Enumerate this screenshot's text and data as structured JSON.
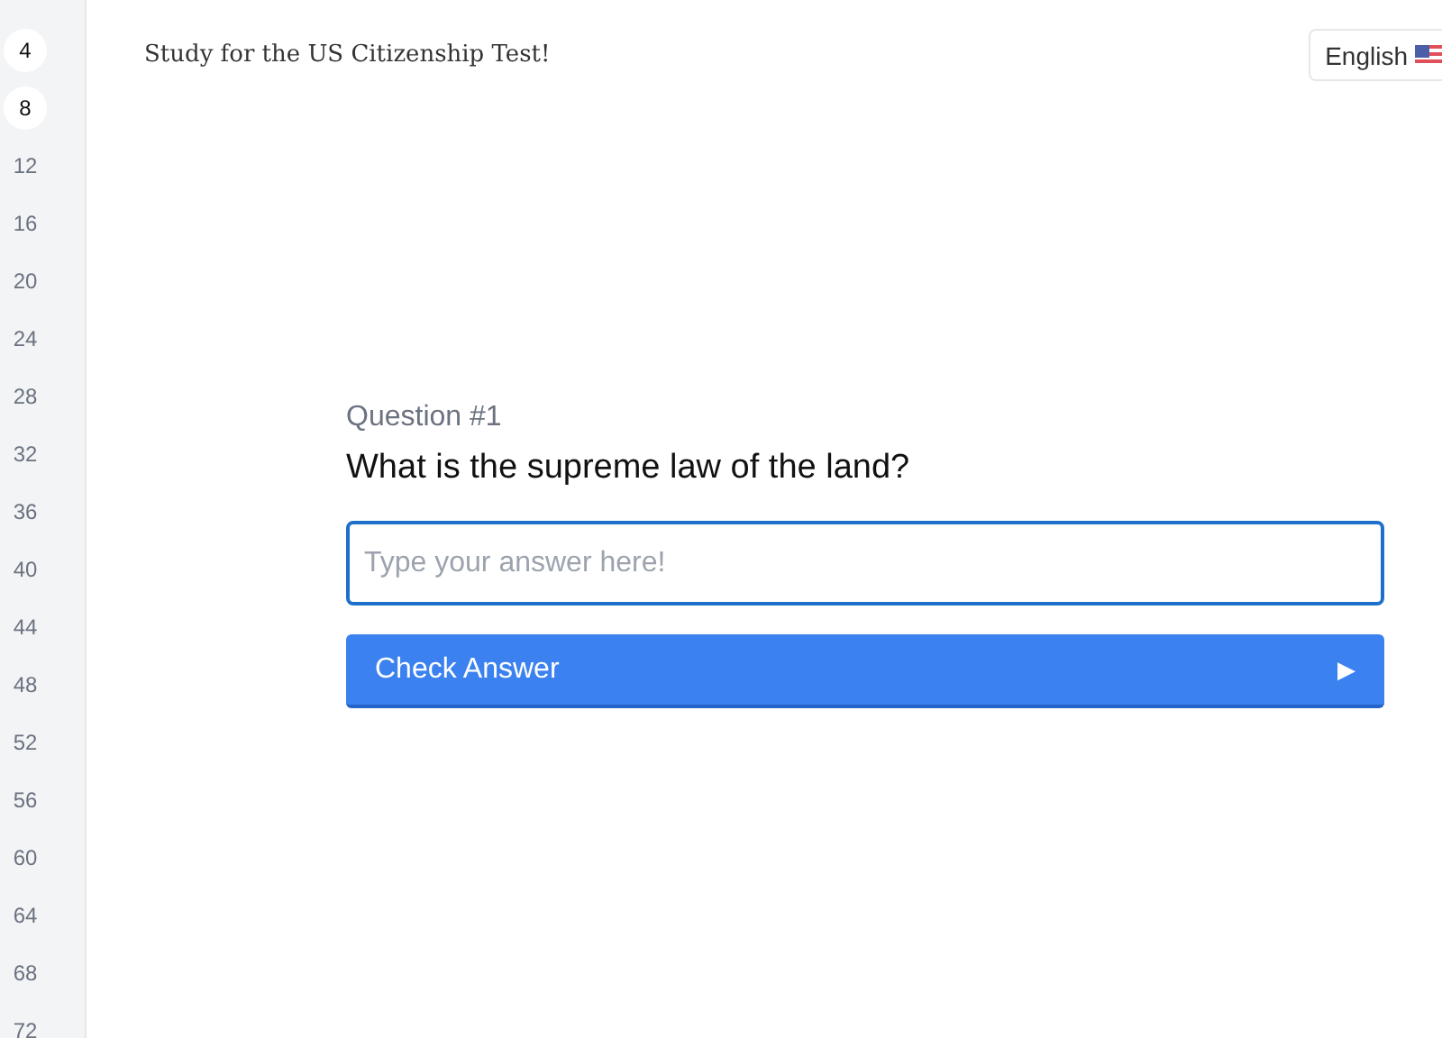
{
  "sidebar": {
    "items": [
      {
        "label": "4",
        "selected": true
      },
      {
        "label": "8",
        "selected": true
      },
      {
        "label": "12",
        "selected": false
      },
      {
        "label": "16",
        "selected": false
      },
      {
        "label": "20",
        "selected": false
      },
      {
        "label": "24",
        "selected": false
      },
      {
        "label": "28",
        "selected": false
      },
      {
        "label": "32",
        "selected": false
      },
      {
        "label": "36",
        "selected": false
      },
      {
        "label": "40",
        "selected": false
      },
      {
        "label": "44",
        "selected": false
      },
      {
        "label": "48",
        "selected": false
      },
      {
        "label": "52",
        "selected": false
      },
      {
        "label": "56",
        "selected": false
      },
      {
        "label": "60",
        "selected": false
      },
      {
        "label": "64",
        "selected": false
      },
      {
        "label": "68",
        "selected": false
      },
      {
        "label": "72",
        "selected": false
      }
    ]
  },
  "header": {
    "title": "Study for the US Citizenship Test!",
    "language_button": "English"
  },
  "quiz": {
    "question_number": "Question #1",
    "question": "What is the supreme law of the land?",
    "answer_placeholder": "Type your answer here!",
    "check_button": "Check Answer",
    "check_button_icon": "▶"
  }
}
